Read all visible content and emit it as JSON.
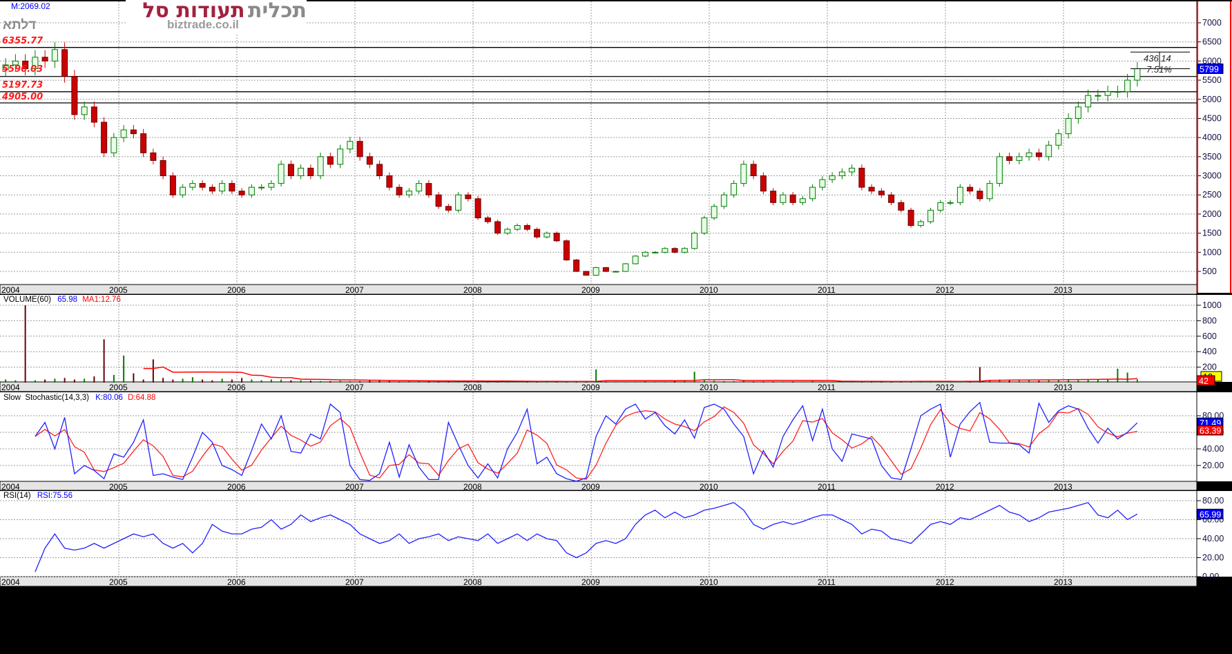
{
  "header": {
    "m_readout": "M:2069.02",
    "symbol_label": "דלתא"
  },
  "logo": {
    "title_red": "תעודות סל",
    "title_grey": "תכלית",
    "site": "biztrade.co.il"
  },
  "colors": {
    "up": "#007a00",
    "down": "#cc0000",
    "k_line": "#2020ff",
    "d_line": "#ff2020",
    "axis_border": "#ff0000",
    "label_blue": "#0000ff",
    "label_red": "#ff0000",
    "label_yellow": "#ffff00"
  },
  "price_levels": [
    {
      "value": 6355.77,
      "label": "6355.77"
    },
    {
      "value": 5596.03,
      "label": "5596.03"
    },
    {
      "value": 5197.73,
      "label": "5197.73"
    },
    {
      "value": 4905.0,
      "label": "4905.00"
    }
  ],
  "measure": {
    "from": 5799,
    "to": 6235.14,
    "diff_label": "436.14",
    "pct_label": "7.51%"
  },
  "chart_data": [
    {
      "type": "candlestick",
      "panel": "price",
      "x_start": "2004-01",
      "x_step": "month",
      "year_labels": [
        "2004",
        "2005",
        "2006",
        "2007",
        "2008",
        "2009",
        "2010",
        "2011",
        "2012",
        "2013"
      ],
      "ylim": [
        0,
        7500
      ],
      "yticks": [
        500,
        1000,
        1500,
        2000,
        2500,
        3000,
        3500,
        4000,
        4500,
        5000,
        5500,
        6000,
        6500,
        7000
      ],
      "grid": true,
      "last_label": "5799",
      "close": [
        5900,
        6000,
        5800,
        6100,
        6000,
        6300,
        5600,
        4600,
        4800,
        4400,
        3600,
        4000,
        4200,
        4100,
        3600,
        3400,
        3000,
        2500,
        2700,
        2800,
        2700,
        2600,
        2800,
        2600,
        2500,
        2700,
        2700,
        2800,
        3300,
        3000,
        3200,
        3000,
        3500,
        3300,
        3700,
        3900,
        3500,
        3300,
        3000,
        2700,
        2500,
        2600,
        2800,
        2500,
        2200,
        2100,
        2500,
        2400,
        1900,
        1800,
        1500,
        1600,
        1700,
        1600,
        1400,
        1500,
        1300,
        800,
        500,
        400,
        600,
        500,
        500,
        700,
        900,
        1000,
        1000,
        1100,
        1000,
        1100,
        1500,
        1900,
        2200,
        2500,
        2800,
        3300,
        3000,
        2600,
        2300,
        2500,
        2300,
        2400,
        2700,
        2900,
        3000,
        3100,
        3200,
        2700,
        2600,
        2500,
        2300,
        2100,
        1700,
        1800,
        2100,
        2300,
        2300,
        2700,
        2600,
        2400,
        2800,
        3500,
        3400,
        3500,
        3600,
        3500,
        3800,
        4100,
        4500,
        4800,
        5100,
        5100,
        5200,
        5200,
        5500,
        5799
      ]
    },
    {
      "type": "bar",
      "panel": "volume",
      "title": "VOLUME(60)",
      "value_label": "65.98",
      "ma_label": "MA1:12.76",
      "ylim": [
        0,
        1100
      ],
      "yticks": [
        200,
        400,
        600,
        800,
        1000
      ],
      "last_label": "42",
      "ma_last_label": "13",
      "values": [
        40,
        30,
        1000,
        30,
        40,
        50,
        60,
        40,
        50,
        80,
        560,
        100,
        350,
        120,
        40,
        300,
        60,
        40,
        50,
        70,
        40,
        30,
        50,
        40,
        60,
        40,
        30,
        40,
        40,
        30,
        30,
        25,
        20,
        20,
        25,
        20,
        20,
        25,
        30,
        20,
        15,
        20,
        30,
        20,
        15,
        15,
        20,
        15,
        15,
        15,
        20,
        15,
        15,
        12,
        15,
        10,
        15,
        20,
        15,
        15,
        170,
        15,
        15,
        12,
        15,
        20,
        15,
        15,
        20,
        25,
        140,
        30,
        25,
        20,
        20,
        25,
        15,
        15,
        15,
        15,
        15,
        12,
        20,
        15,
        15,
        20,
        15,
        15,
        15,
        20,
        15,
        15,
        20,
        15,
        15,
        15,
        15,
        20,
        15,
        200,
        30,
        40,
        30,
        25,
        30,
        25,
        30,
        35,
        40,
        30,
        35,
        40,
        45,
        180,
        130,
        42
      ]
    },
    {
      "type": "line",
      "panel": "stochastic",
      "title": "Slow  Stochastic(14,3,3)",
      "k_label": "K:80.06",
      "d_label": "D:64.88",
      "ylim": [
        0,
        100
      ],
      "yticks": [
        20,
        40,
        60,
        80
      ],
      "ytick_labels": [
        "20.00",
        "40.00",
        "60.00",
        "80.00"
      ],
      "k_last_label": "71.49",
      "d_last_label": "63.39",
      "k": [
        null,
        null,
        null,
        55,
        72,
        40,
        78,
        10,
        20,
        14,
        4,
        34,
        30,
        48,
        75,
        8,
        10,
        6,
        3,
        30,
        60,
        48,
        20,
        15,
        8,
        38,
        70,
        52,
        80,
        37,
        35,
        58,
        52,
        94,
        84,
        20,
        3,
        2,
        10,
        48,
        6,
        45,
        18,
        3,
        3,
        72,
        45,
        20,
        5,
        22,
        5,
        40,
        60,
        88,
        22,
        30,
        10,
        4,
        1,
        5,
        55,
        80,
        70,
        88,
        94,
        76,
        84,
        68,
        58,
        75,
        53,
        90,
        94,
        88,
        70,
        55,
        10,
        38,
        18,
        55,
        75,
        92,
        50,
        88,
        40,
        25,
        58,
        55,
        52,
        20,
        5,
        3,
        40,
        80,
        88,
        94,
        30,
        70,
        85,
        96,
        48,
        47,
        47,
        45,
        35,
        95,
        72,
        86,
        92,
        88,
        65,
        47,
        65,
        52,
        60,
        71.49
      ]
    },
    {
      "type": "line",
      "panel": "rsi",
      "title": "RSI(14)",
      "value_label": "RSI:75.56",
      "ylim": [
        0,
        90
      ],
      "yticks": [
        0,
        20,
        40,
        60,
        80
      ],
      "ytick_labels": [
        "0.00",
        "20.00",
        "40.00",
        "60.00",
        "80.00"
      ],
      "last_label": "65.99",
      "values": [
        null,
        null,
        null,
        5,
        30,
        45,
        30,
        28,
        30,
        35,
        30,
        35,
        40,
        45,
        42,
        45,
        35,
        30,
        35,
        25,
        35,
        55,
        48,
        45,
        45,
        50,
        52,
        60,
        50,
        55,
        65,
        58,
        62,
        65,
        60,
        55,
        45,
        40,
        35,
        38,
        45,
        35,
        40,
        42,
        45,
        38,
        42,
        40,
        38,
        45,
        35,
        40,
        45,
        38,
        45,
        40,
        38,
        25,
        20,
        25,
        35,
        38,
        35,
        40,
        55,
        65,
        70,
        62,
        68,
        62,
        65,
        70,
        72,
        75,
        78,
        70,
        55,
        50,
        55,
        58,
        55,
        58,
        62,
        65,
        65,
        60,
        55,
        45,
        50,
        48,
        40,
        38,
        35,
        45,
        55,
        58,
        55,
        62,
        60,
        65,
        70,
        75,
        68,
        65,
        58,
        62,
        68,
        70,
        72,
        75,
        78,
        65,
        62,
        70,
        60,
        65.99
      ]
    }
  ]
}
